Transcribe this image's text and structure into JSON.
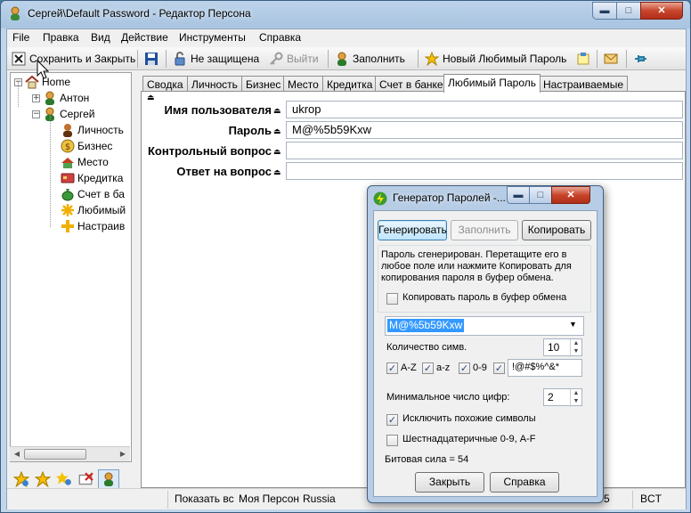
{
  "window": {
    "title": "Сергей\\Default Password - Редактор Персона",
    "min_label": "▬",
    "max_label": "□",
    "close_label": "✕"
  },
  "menu": [
    "File",
    "Правка",
    "Вид",
    "Действие",
    "Инструменты",
    "Справка"
  ],
  "toolbar": {
    "save_close": "Сохранить и Закрыть",
    "not_protected": "Не защищена",
    "logout": "Выйти",
    "fill": "Заполнить",
    "new_fav_password": "Новый Любимый Пароль"
  },
  "tree": {
    "root": "Home",
    "persons": [
      "Антон",
      "Сергей"
    ],
    "children": [
      "Личность",
      "Бизнес",
      "Место",
      "Кредитка",
      "Счет в ба",
      "Любимый",
      "Настраив"
    ]
  },
  "tabs": [
    "Сводка",
    "Личность",
    "Бизнес",
    "Место",
    "Кредитка",
    "Счет в банке",
    "Любимый Пароль",
    "Настраиваемые"
  ],
  "active_tab_index": 6,
  "form": {
    "fields": [
      {
        "label": "Имя пользователя",
        "value": "ukrop"
      },
      {
        "label": "Пароль",
        "value": "M@%5b59Kxw"
      },
      {
        "label": "Контрольный вопрос",
        "value": ""
      },
      {
        "label": "Ответ на вопрос",
        "value": ""
      }
    ]
  },
  "status": {
    "show_all": "Показать вс",
    "my_person": "Моя Персон",
    "country": "Russia",
    "digit": "5",
    "timezone": "BCT"
  },
  "dialog": {
    "title": "Генератор Паролей -...",
    "generate": "Генерировать",
    "fill": "Заполнить",
    "copy": "Копировать",
    "info": "Пароль сгенерирован. Перетащите его в любое поле или нажмите Копировать для копирования пароля в буфер обмена.",
    "copy_to_clipboard": "Копировать пароль в буфер обмена",
    "copy_to_clipboard_checked": false,
    "password": "M@%5b59Kxw",
    "length_label": "Количество симв.",
    "length": "10",
    "sets": [
      {
        "label": "A-Z",
        "checked": true
      },
      {
        "label": "a-z",
        "checked": true
      },
      {
        "label": "0-9",
        "checked": true
      }
    ],
    "symbols_checked": true,
    "symbols": "!@#$%^&*",
    "min_digits_label": "Минимальное число цифр:",
    "min_digits": "2",
    "exclude_similar": "Исключить похожие символы",
    "exclude_similar_checked": true,
    "hex": "Шестнадцатеричные 0-9, A-F",
    "hex_checked": false,
    "strength": "Битовая сила = 54",
    "close": "Закрыть",
    "help": "Справка"
  },
  "colors": {
    "accent": "#3399ff",
    "selection": "#3399ff"
  }
}
